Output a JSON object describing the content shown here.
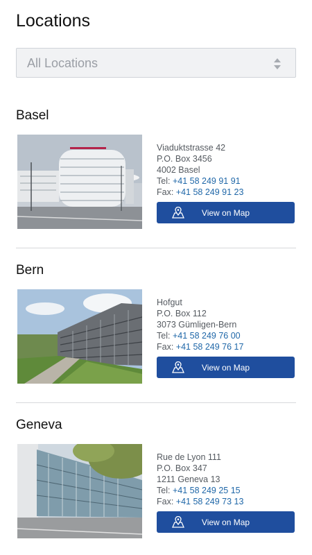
{
  "page": {
    "title": "Locations"
  },
  "filter": {
    "selected": "All Locations"
  },
  "locations": [
    {
      "city": "Basel",
      "street": "Viaduktstrasse 42",
      "pobox": "P.O. Box 3456",
      "postal": "4002 Basel",
      "tel_label": "Tel:",
      "tel": "+41 58 249 91 91",
      "fax_label": "Fax:",
      "fax": "+41 58 249 91 23",
      "map_label": "View on Map"
    },
    {
      "city": "Bern",
      "street": "Hofgut",
      "pobox": "P.O. Box 112",
      "postal": "3073 Gümligen-Bern",
      "tel_label": "Tel:",
      "tel": "+41 58 249 76 00",
      "fax_label": "Fax:",
      "fax": "+41 58 249 76 17",
      "map_label": "View on Map"
    },
    {
      "city": "Geneva",
      "street": "Rue de Lyon 111",
      "pobox": "P.O. Box 347",
      "postal": "1211 Geneva 13",
      "tel_label": "Tel:",
      "tel": "+41 58 249 25 15",
      "fax_label": "Fax:",
      "fax": "+41 58 249 73 13",
      "map_label": "View on Map"
    }
  ],
  "colors": {
    "button": "#1f4e9e",
    "link": "#1f67a8",
    "divider": "#d6d8db"
  },
  "icons": {
    "select": "sort-arrows-icon",
    "map": "map-pin-icon"
  }
}
